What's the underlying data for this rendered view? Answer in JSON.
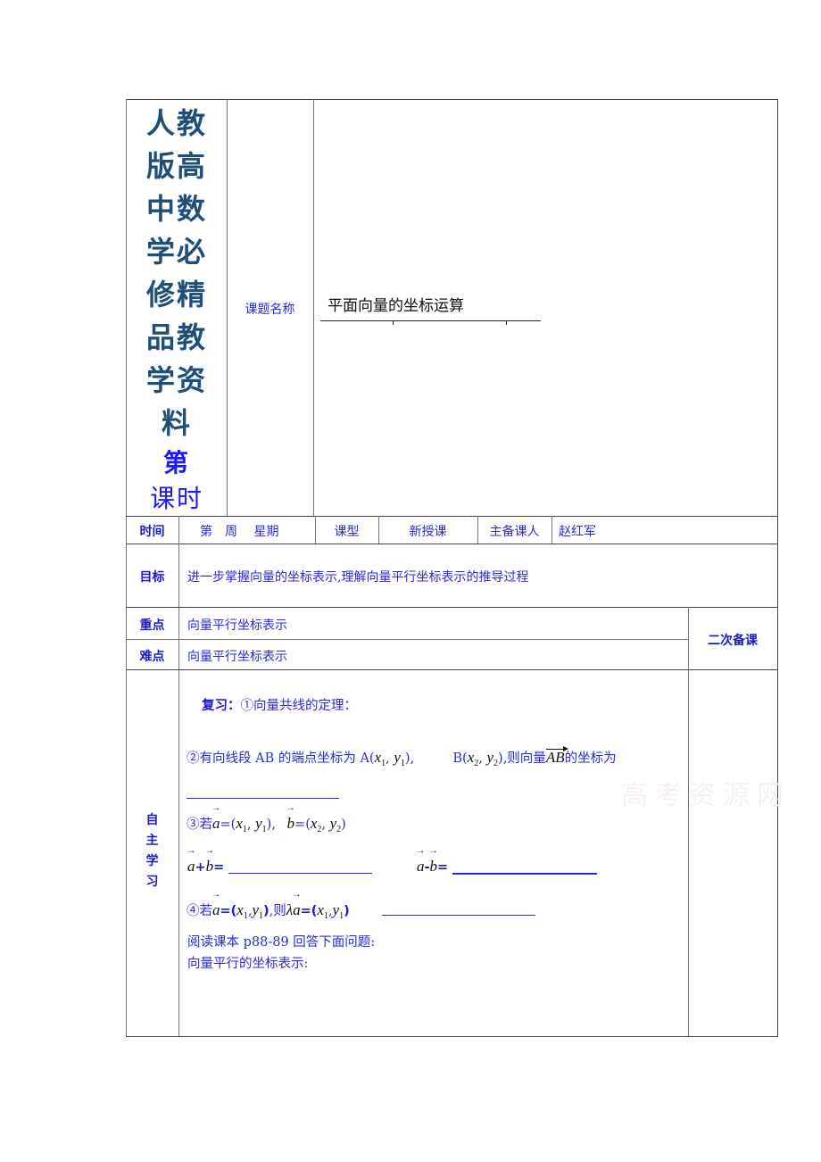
{
  "header": {
    "title_lines": [
      "人教",
      "版高",
      "中数",
      "学必",
      "修精",
      "品教",
      "学资",
      "料"
    ],
    "period_prefix": "第",
    "period_suffix": "课时",
    "topic_label": "课题名称",
    "topic_value": "平面向量的坐标运算"
  },
  "info_row": {
    "time_label": "时间",
    "week": "第　周　 星期",
    "type_label": "课型",
    "type_value": "新授课",
    "preparer_label": "主备课人",
    "preparer_value": "赵红军"
  },
  "goal": {
    "label": "目标",
    "text": "进一步掌握向量的坐标表示,理解向量平行坐标表示的推导过程"
  },
  "key_point": {
    "label": "重点",
    "text": "向量平行坐标表示"
  },
  "difficulty": {
    "label": "难点",
    "text": "向量平行坐标表示"
  },
  "second_prep_label": "二次备课",
  "self_study": {
    "label_chars": [
      "自",
      "主",
      "学",
      "习"
    ],
    "review_label": "复习：",
    "item1": "①向量共线的定理：",
    "item2_prefix": "②有向线段 AB 的端点坐标为 A(",
    "item2_mid": "),",
    "item2_b": "B(",
    "item2_suffix": "),则向量",
    "item2_end": "的坐标为",
    "item3_prefix": "③若",
    "item4_prefix": "④若",
    "item4_then": ",则",
    "reading": "阅读课本 p88-89 回答下面问题:",
    "parallel": "向量平行的坐标表示:",
    "watermark": "高考资源网"
  },
  "math": {
    "x1": "x",
    "y1": "y",
    "x2": "x",
    "y2": "y",
    "s1": "1",
    "s2": "2",
    "a": "a",
    "b": "b",
    "AB": "AB",
    "lambda": "λ",
    "eq": "=",
    "plus": "+",
    "minus": "-",
    "comma": ",",
    "lp": "(",
    "rp": ")"
  }
}
